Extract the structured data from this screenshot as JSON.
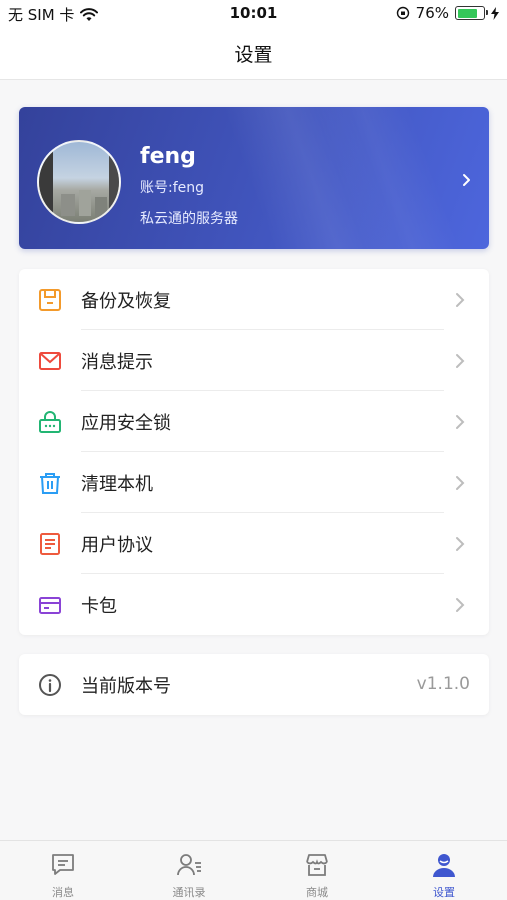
{
  "status_bar": {
    "carrier": "无 SIM 卡",
    "time": "10:01",
    "battery": "76%",
    "battery_level": 0.76
  },
  "nav": {
    "title": "设置"
  },
  "profile": {
    "name": "feng",
    "account": "账号:feng",
    "server": "私云通的服务器"
  },
  "settings": {
    "items": [
      {
        "label": "备份及恢复",
        "icon": "backup-icon",
        "color": "#f39a2b"
      },
      {
        "label": "消息提示",
        "icon": "mail-icon",
        "color": "#ee4a3d"
      },
      {
        "label": "应用安全锁",
        "icon": "lock-icon",
        "color": "#22b573"
      },
      {
        "label": "清理本机",
        "icon": "trash-icon",
        "color": "#2a9df4"
      },
      {
        "label": "用户协议",
        "icon": "document-icon",
        "color": "#ee5a3d"
      },
      {
        "label": "卡包",
        "icon": "card-icon",
        "color": "#8a43d6"
      }
    ]
  },
  "version": {
    "label": "当前版本号",
    "value": "v1.1.0"
  },
  "tabs": [
    {
      "label": "消息",
      "icon": "message-icon"
    },
    {
      "label": "通讯录",
      "icon": "contacts-icon"
    },
    {
      "label": "商城",
      "icon": "store-icon"
    },
    {
      "label": "设置",
      "icon": "user-settings-icon"
    }
  ],
  "colors": {
    "accent": "#3f57cf",
    "card_gradient_start": "#34429b",
    "card_gradient_end": "#4d66dd"
  }
}
